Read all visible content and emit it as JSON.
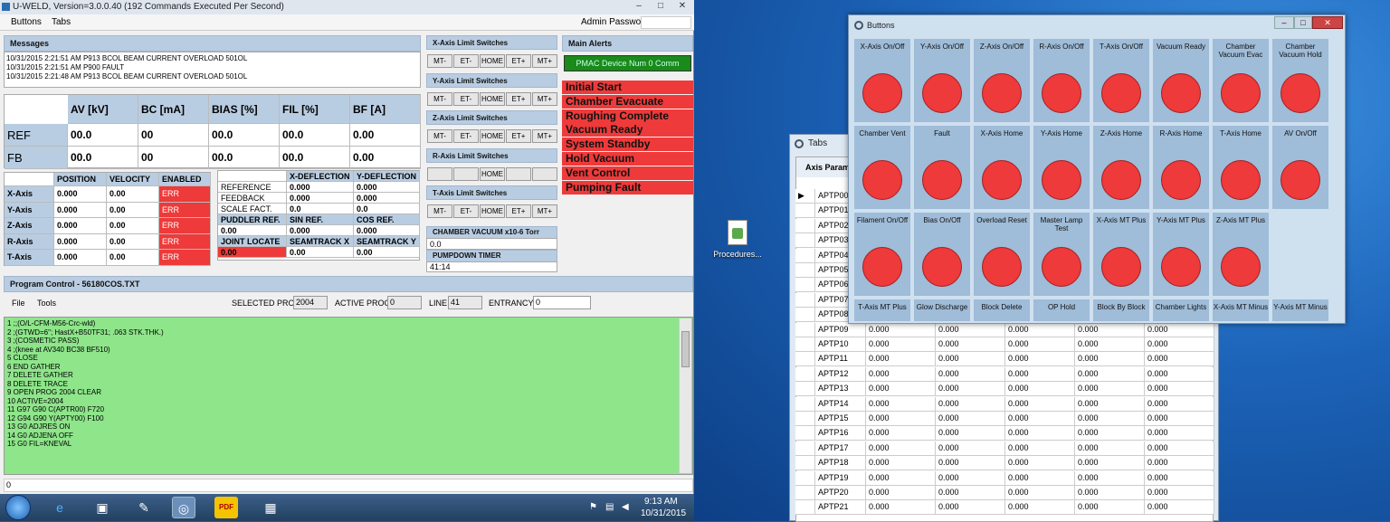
{
  "window": {
    "title": "U-WELD, Version=3.0.0.40 (192 Commands Executed Per Second)",
    "menu": [
      "Buttons",
      "Tabs"
    ],
    "admin_label": "Admin Password:"
  },
  "messages": {
    "title": "Messages",
    "lines": [
      "10/31/2015 2:21:51 AM P913 BCOL  BEAM CURRENT OVERLOAD 501OL",
      "10/31/2015 2:21:51 AM P900 FAULT",
      "10/31/2015 2:21:48 AM P913 BCOL  BEAM CURRENT OVERLOAD 501OL"
    ]
  },
  "readings": {
    "headers": [
      "AV [kV]",
      "BC [mA]",
      "BIAS [%]",
      "FIL [%]",
      "BF [A]"
    ],
    "rows": [
      {
        "label": "REF",
        "values": [
          "00.0",
          "00",
          "00.0",
          "00.0",
          "0.00"
        ]
      },
      {
        "label": "FB",
        "values": [
          "00.0",
          "00",
          "00.0",
          "00.0",
          "0.00"
        ]
      }
    ]
  },
  "axes": {
    "headers": [
      "POSITION",
      "VELOCITY",
      "ENABLED"
    ],
    "rows": [
      {
        "label": "X-Axis",
        "pos": "0.000",
        "vel": "0.00",
        "en": "ERR"
      },
      {
        "label": "Y-Axis",
        "pos": "0.000",
        "vel": "0.00",
        "en": "ERR"
      },
      {
        "label": "Z-Axis",
        "pos": "0.000",
        "vel": "0.00",
        "en": "ERR"
      },
      {
        "label": "R-Axis",
        "pos": "0.000",
        "vel": "0.00",
        "en": "ERR"
      },
      {
        "label": "T-Axis",
        "pos": "0.000",
        "vel": "0.00",
        "en": "ERR"
      }
    ]
  },
  "deflection": {
    "headers": [
      "X-DEFLECTION",
      "Y-DEFLECTION"
    ],
    "rows": [
      {
        "label": "REFERENCE",
        "x": "0.000",
        "y": "0.000"
      },
      {
        "label": "FEEDBACK",
        "x": "0.000",
        "y": "0.000"
      },
      {
        "label": "SCALE FACT.",
        "x": "0.0",
        "y": "0.0"
      }
    ],
    "puddler": [
      "PUDDLER REF.",
      "SIN REF.",
      "COS REF."
    ],
    "puddler_vals": [
      "0.00",
      "0.000",
      "0.000"
    ],
    "joint": [
      "JOINT LOCATE",
      "SEAMTRACK X",
      "SEAMTRACK Y"
    ],
    "joint_vals": [
      "0.00",
      "0.00",
      "0.00"
    ]
  },
  "limits": {
    "groups": [
      {
        "title": "X-Axis Limit Switches",
        "btns": [
          "MT-",
          "ET-",
          "HOME",
          "ET+",
          "MT+"
        ]
      },
      {
        "title": "Y-Axis Limit Switches",
        "btns": [
          "MT-",
          "ET-",
          "HOME",
          "ET+",
          "MT+"
        ]
      },
      {
        "title": "Z-Axis Limit Switches",
        "btns": [
          "MT-",
          "ET-",
          "HOME",
          "ET+",
          "MT+"
        ]
      },
      {
        "title": "R-Axis Limit Switches",
        "btns": [
          "",
          "",
          "HOME",
          "",
          ""
        ]
      },
      {
        "title": "T-Axis Limit Switches",
        "btns": [
          "MT-",
          "ET-",
          "HOME",
          "ET+",
          "MT+"
        ]
      }
    ],
    "vacuum_label": "CHAMBER VACUUM x10-6 Torr",
    "vacuum_val": "0.0",
    "timer_label": "PUMPDOWN TIMER",
    "timer_val": "41:14"
  },
  "alerts": {
    "title": "Main Alerts",
    "device": "PMAC Device Num 0 Comm",
    "items": [
      "Initial Start",
      "Chamber Evacuate",
      "Roughing Complete",
      "Vacuum Ready",
      "System Standby",
      "Hold Vacuum",
      "Vent Control",
      "Pumping Fault"
    ]
  },
  "program": {
    "title": "Program Control - 56180COS.TXT",
    "menu": [
      "File",
      "Tools"
    ],
    "sel_label": "SELECTED PROG",
    "sel_val": "2004",
    "act_label": "ACTIVE PROG",
    "act_val": "0",
    "line_label": "LINE",
    "line_val": "41",
    "ent_label": "ENTRANCY",
    "ent_val": "0",
    "status": "0",
    "code": [
      "1 ;;(O/L-CFM-M56-Crc-wld)",
      "2 ;(GTWD=6\"; HastX+B50TF31; .063 STK.THK.)",
      "3 ;(COSMETIC PASS)",
      "4 ;(knee at AV340 BC38 BF510)",
      "5 CLOSE",
      "6 END GATHER",
      "7 DELETE GATHER",
      "8 DELETE TRACE",
      "9 OPEN PROG 2004 CLEAR",
      "10 ACTIVE=2004",
      "11 G97  G90 C(APTR00)  F720",
      "12 G94  G90  Y(APTY00)  F100",
      "13 G0 ADJRES ON",
      "14 G0 ADJENA OFF",
      "15 G0 FIL=KNEVAL"
    ]
  },
  "buttons_win": {
    "title": "Buttons",
    "tiles": [
      "X-Axis On/Off",
      "Y-Axis On/Off",
      "Z-Axis On/Off",
      "R-Axis On/Off",
      "T-Axis On/Off",
      "Vacuum Ready",
      "Chamber Vacuum Evac",
      "Chamber Vacuum Hold",
      "Chamber Vent",
      "Fault",
      "X-Axis Home",
      "Y-Axis Home",
      "Z-Axis Home",
      "R-Axis Home",
      "T-Axis Home",
      "AV On/Off",
      "Filament On/Off",
      "Bias On/Off",
      "Overload Reset",
      "Master Lamp Test",
      "X-Axis MT Plus",
      "Y-Axis MT Plus",
      "Z-Axis MT Plus",
      "",
      "T-Axis MT Plus",
      "Glow Discharge",
      "Block Delete",
      "OP Hold",
      "Block By Block",
      "Chamber Lights",
      "X-Axis MT Minus",
      "Y-Axis MT Minus"
    ]
  },
  "tabs_win": {
    "title": "Tabs",
    "tab": "Axis Param",
    "rows": [
      "APTP00",
      "APTP01",
      "APTP02",
      "APTP03",
      "APTP04",
      "APTP05",
      "APTP06",
      "APTP07",
      "APTP08",
      "APTP09",
      "APTP10",
      "APTP11",
      "APTP12",
      "APTP13",
      "APTP14",
      "APTP15",
      "APTP16",
      "APTP17",
      "APTP18",
      "APTP19",
      "APTP20",
      "APTP21"
    ],
    "val": "0.000"
  },
  "desktop": {
    "icon_label": "Procedures..."
  },
  "taskbar": {
    "time": "9:13 AM",
    "date": "10/31/2015",
    "pdf": "PDF"
  }
}
